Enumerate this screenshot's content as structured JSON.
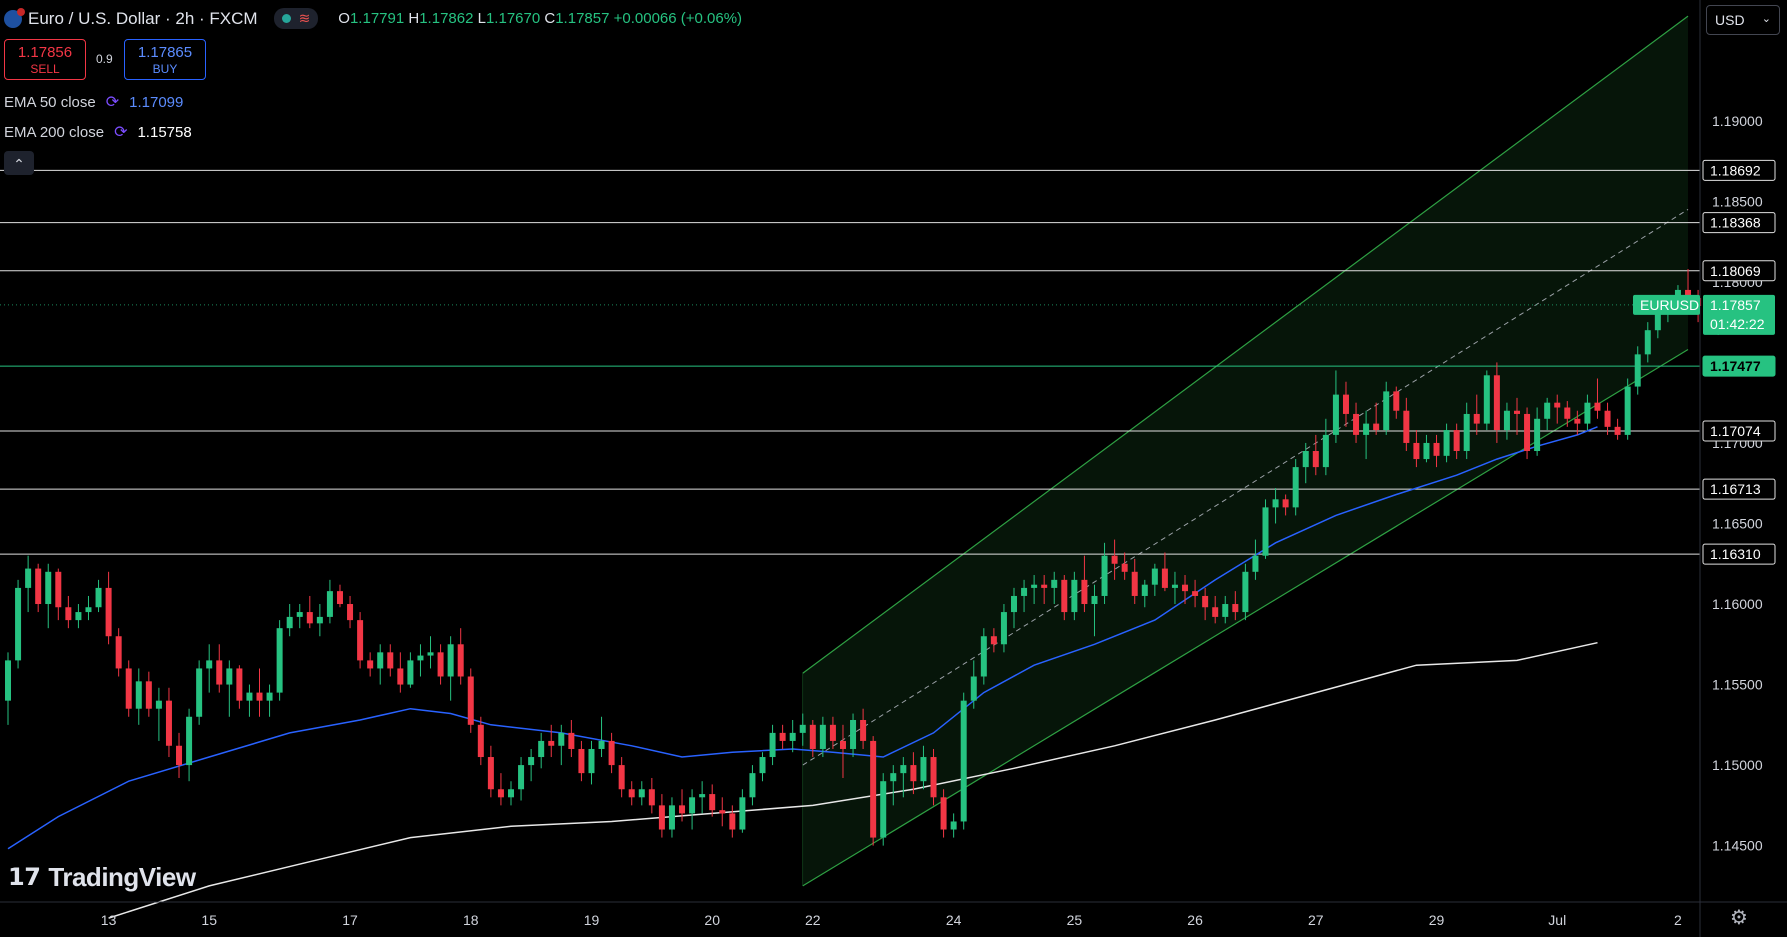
{
  "header": {
    "title": "Euro / U.S. Dollar · 2h · FXCM",
    "ohlc": {
      "o_label": "O",
      "o": "1.17791",
      "h_label": "H",
      "h": "1.17862",
      "l_label": "L",
      "l": "1.17670",
      "c_label": "C",
      "c": "1.17857",
      "change": "+0.00066 (+0.06%)"
    }
  },
  "trade": {
    "sell_price": "1.17856",
    "sell_label": "SELL",
    "spread": "0.9",
    "buy_price": "1.17865",
    "buy_label": "BUY"
  },
  "indicators": {
    "ema50_label": "EMA 50 close",
    "ema50_value": "1.17099",
    "ema200_label": "EMA 200 close",
    "ema200_value": "1.15758"
  },
  "currency_selector": "USD",
  "logo_text": "TradingView",
  "colors": {
    "background": "#000000",
    "up": "#26c281",
    "down": "#f23645",
    "ema50": "#2962ff",
    "ema200": "#e8e8e8",
    "channel": "#2ea043",
    "channel_fill": "rgba(46,160,67,0.13)",
    "price_tag": "#26c281",
    "axis_text": "#d1d4dc"
  },
  "chart_data": {
    "type": "candlestick",
    "symbol": "EURUSD",
    "last_price": "1.17857",
    "countdown": "01:42:22",
    "y_range": [
      1.1415,
      1.1975
    ],
    "y_ticks": [
      "1.19000",
      "1.18500",
      "1.18000",
      "1.17000",
      "1.16500",
      "1.16000",
      "1.15500",
      "1.15000",
      "1.14500"
    ],
    "x_ticks": [
      {
        "label": "13",
        "i": 10
      },
      {
        "label": "15",
        "i": 20
      },
      {
        "label": "17",
        "i": 34
      },
      {
        "label": "18",
        "i": 46
      },
      {
        "label": "19",
        "i": 58
      },
      {
        "label": "20",
        "i": 70
      },
      {
        "label": "22",
        "i": 80
      },
      {
        "label": "24",
        "i": 94
      },
      {
        "label": "25",
        "i": 106
      },
      {
        "label": "26",
        "i": 118
      },
      {
        "label": "27",
        "i": 130
      },
      {
        "label": "29",
        "i": 142
      },
      {
        "label": "Jul",
        "i": 154
      },
      {
        "label": "2",
        "i": 166
      }
    ],
    "horizontal_levels": [
      {
        "label": "1.18692",
        "value": 1.18692,
        "color": "#e0e0e0"
      },
      {
        "label": "1.18368",
        "value": 1.18368,
        "color": "#e0e0e0"
      },
      {
        "label": "1.18069",
        "value": 1.18069,
        "color": "#e0e0e0"
      },
      {
        "label": "1.17477",
        "value": 1.17477,
        "color": "#26c281"
      },
      {
        "label": "1.17074",
        "value": 1.17074,
        "color": "#e0e0e0"
      },
      {
        "label": "1.16713",
        "value": 1.16713,
        "color": "#e0e0e0"
      },
      {
        "label": "1.16310",
        "value": 1.1631,
        "color": "#e0e0e0"
      }
    ],
    "channel": {
      "start_i": 79,
      "end_i": 167,
      "upper": [
        1.1557,
        1.1965
      ],
      "mid": [
        1.15,
        1.1845
      ],
      "lower": [
        1.1425,
        1.1758
      ]
    },
    "candles": [
      [
        1.154,
        1.157,
        1.1525,
        1.1565
      ],
      [
        1.1565,
        1.1615,
        1.156,
        1.161
      ],
      [
        1.161,
        1.163,
        1.1595,
        1.1622
      ],
      [
        1.1622,
        1.1625,
        1.1595,
        1.16
      ],
      [
        1.16,
        1.1625,
        1.1585,
        1.162
      ],
      [
        1.162,
        1.1622,
        1.159,
        1.1598
      ],
      [
        1.1598,
        1.1605,
        1.1585,
        1.159
      ],
      [
        1.159,
        1.16,
        1.1585,
        1.1595
      ],
      [
        1.1595,
        1.1605,
        1.159,
        1.1598
      ],
      [
        1.1598,
        1.1615,
        1.1595,
        1.161
      ],
      [
        1.161,
        1.162,
        1.1575,
        1.158
      ],
      [
        1.158,
        1.1585,
        1.1555,
        1.156
      ],
      [
        1.156,
        1.1565,
        1.153,
        1.1535
      ],
      [
        1.1535,
        1.156,
        1.1525,
        1.1552
      ],
      [
        1.1552,
        1.1558,
        1.153,
        1.1535
      ],
      [
        1.1535,
        1.1548,
        1.1515,
        1.154
      ],
      [
        1.154,
        1.1548,
        1.1505,
        1.1512
      ],
      [
        1.1512,
        1.152,
        1.1492,
        1.15
      ],
      [
        1.15,
        1.1535,
        1.149,
        1.153
      ],
      [
        1.153,
        1.1565,
        1.1525,
        1.156
      ],
      [
        1.156,
        1.1575,
        1.1545,
        1.1565
      ],
      [
        1.1565,
        1.1575,
        1.1545,
        1.155
      ],
      [
        1.155,
        1.1565,
        1.153,
        1.156
      ],
      [
        1.156,
        1.1562,
        1.1535,
        1.154
      ],
      [
        1.154,
        1.155,
        1.153,
        1.1545
      ],
      [
        1.1545,
        1.156,
        1.153,
        1.154
      ],
      [
        1.154,
        1.155,
        1.153,
        1.1545
      ],
      [
        1.1545,
        1.159,
        1.154,
        1.1585
      ],
      [
        1.1585,
        1.16,
        1.158,
        1.1592
      ],
      [
        1.1592,
        1.16,
        1.1585,
        1.1595
      ],
      [
        1.1595,
        1.1605,
        1.1585,
        1.1588
      ],
      [
        1.1588,
        1.16,
        1.158,
        1.1592
      ],
      [
        1.1592,
        1.1615,
        1.1588,
        1.1608
      ],
      [
        1.1608,
        1.1612,
        1.1598,
        1.16
      ],
      [
        1.16,
        1.1605,
        1.1585,
        1.159
      ],
      [
        1.159,
        1.1595,
        1.156,
        1.1565
      ],
      [
        1.1565,
        1.157,
        1.1555,
        1.156
      ],
      [
        1.156,
        1.1575,
        1.155,
        1.157
      ],
      [
        1.157,
        1.1575,
        1.1555,
        1.156
      ],
      [
        1.156,
        1.157,
        1.1545,
        1.155
      ],
      [
        1.155,
        1.157,
        1.1548,
        1.1565
      ],
      [
        1.1565,
        1.1575,
        1.1555,
        1.1568
      ],
      [
        1.1568,
        1.158,
        1.156,
        1.157
      ],
      [
        1.157,
        1.1575,
        1.155,
        1.1555
      ],
      [
        1.1555,
        1.158,
        1.154,
        1.1575
      ],
      [
        1.1575,
        1.1585,
        1.155,
        1.1555
      ],
      [
        1.1555,
        1.156,
        1.152,
        1.1525
      ],
      [
        1.1525,
        1.153,
        1.15,
        1.1505
      ],
      [
        1.1505,
        1.1512,
        1.148,
        1.1485
      ],
      [
        1.1485,
        1.1495,
        1.1475,
        1.148
      ],
      [
        1.148,
        1.149,
        1.1475,
        1.1485
      ],
      [
        1.1485,
        1.1505,
        1.1478,
        1.15
      ],
      [
        1.15,
        1.151,
        1.149,
        1.1505
      ],
      [
        1.1505,
        1.152,
        1.1498,
        1.1515
      ],
      [
        1.1515,
        1.1525,
        1.1505,
        1.1512
      ],
      [
        1.1512,
        1.1525,
        1.15,
        1.152
      ],
      [
        1.152,
        1.1528,
        1.1505,
        1.151
      ],
      [
        1.151,
        1.1515,
        1.149,
        1.1495
      ],
      [
        1.1495,
        1.1515,
        1.1488,
        1.151
      ],
      [
        1.151,
        1.153,
        1.1505,
        1.1515
      ],
      [
        1.1515,
        1.152,
        1.1495,
        1.15
      ],
      [
        1.15,
        1.1505,
        1.148,
        1.1485
      ],
      [
        1.1485,
        1.149,
        1.1475,
        1.148
      ],
      [
        1.148,
        1.149,
        1.1475,
        1.1485
      ],
      [
        1.1485,
        1.1492,
        1.147,
        1.1475
      ],
      [
        1.1475,
        1.1482,
        1.1455,
        1.146
      ],
      [
        1.146,
        1.148,
        1.1455,
        1.1475
      ],
      [
        1.1475,
        1.1485,
        1.1465,
        1.147
      ],
      [
        1.147,
        1.1485,
        1.146,
        1.148
      ],
      [
        1.148,
        1.149,
        1.147,
        1.1482
      ],
      [
        1.1482,
        1.1488,
        1.1468,
        1.1472
      ],
      [
        1.1472,
        1.148,
        1.1462,
        1.147
      ],
      [
        1.147,
        1.1475,
        1.1455,
        1.146
      ],
      [
        1.146,
        1.1485,
        1.1458,
        1.148
      ],
      [
        1.148,
        1.15,
        1.1475,
        1.1495
      ],
      [
        1.1495,
        1.1508,
        1.149,
        1.1505
      ],
      [
        1.1505,
        1.1525,
        1.15,
        1.152
      ],
      [
        1.152,
        1.1525,
        1.151,
        1.1515
      ],
      [
        1.1515,
        1.1528,
        1.1508,
        1.152
      ],
      [
        1.152,
        1.1532,
        1.1512,
        1.1525
      ],
      [
        1.1525,
        1.1528,
        1.1505,
        1.151
      ],
      [
        1.151,
        1.153,
        1.1505,
        1.1525
      ],
      [
        1.1525,
        1.153,
        1.151,
        1.1515
      ],
      [
        1.1515,
        1.1525,
        1.1492,
        1.151
      ],
      [
        1.151,
        1.1532,
        1.1505,
        1.1528
      ],
      [
        1.1528,
        1.1535,
        1.151,
        1.1515
      ],
      [
        1.1515,
        1.1518,
        1.145,
        1.1455
      ],
      [
        1.1455,
        1.1495,
        1.145,
        1.149
      ],
      [
        1.149,
        1.15,
        1.1475,
        1.1495
      ],
      [
        1.1495,
        1.1505,
        1.148,
        1.15
      ],
      [
        1.15,
        1.1508,
        1.1482,
        1.149
      ],
      [
        1.149,
        1.1512,
        1.1485,
        1.1505
      ],
      [
        1.1505,
        1.151,
        1.1475,
        1.148
      ],
      [
        1.148,
        1.1485,
        1.1455,
        1.146
      ],
      [
        1.146,
        1.147,
        1.1455,
        1.1465
      ],
      [
        1.1465,
        1.1545,
        1.146,
        1.154
      ],
      [
        1.154,
        1.1565,
        1.1535,
        1.1555
      ],
      [
        1.1555,
        1.1585,
        1.155,
        1.158
      ],
      [
        1.158,
        1.1585,
        1.157,
        1.1575
      ],
      [
        1.1575,
        1.16,
        1.157,
        1.1595
      ],
      [
        1.1595,
        1.161,
        1.1585,
        1.1605
      ],
      [
        1.1605,
        1.1615,
        1.1595,
        1.161
      ],
      [
        1.161,
        1.1618,
        1.16,
        1.1612
      ],
      [
        1.1612,
        1.1618,
        1.16,
        1.161
      ],
      [
        1.161,
        1.162,
        1.16,
        1.1615
      ],
      [
        1.1615,
        1.1618,
        1.159,
        1.1595
      ],
      [
        1.1595,
        1.162,
        1.159,
        1.1615
      ],
      [
        1.1615,
        1.163,
        1.1595,
        1.16
      ],
      [
        1.16,
        1.1612,
        1.158,
        1.1605
      ],
      [
        1.1605,
        1.1638,
        1.16,
        1.163
      ],
      [
        1.163,
        1.164,
        1.1615,
        1.1625
      ],
      [
        1.1625,
        1.1632,
        1.1615,
        1.162
      ],
      [
        1.162,
        1.1628,
        1.16,
        1.1605
      ],
      [
        1.1605,
        1.1615,
        1.1598,
        1.1612
      ],
      [
        1.1612,
        1.1625,
        1.1605,
        1.1622
      ],
      [
        1.1622,
        1.1632,
        1.1608,
        1.161
      ],
      [
        1.161,
        1.162,
        1.16,
        1.1612
      ],
      [
        1.1612,
        1.1618,
        1.16,
        1.1608
      ],
      [
        1.1608,
        1.1615,
        1.1598,
        1.1605
      ],
      [
        1.1605,
        1.161,
        1.159,
        1.1598
      ],
      [
        1.1598,
        1.1605,
        1.1588,
        1.1592
      ],
      [
        1.1592,
        1.1605,
        1.1588,
        1.16
      ],
      [
        1.16,
        1.1608,
        1.159,
        1.1595
      ],
      [
        1.1595,
        1.1625,
        1.159,
        1.162
      ],
      [
        1.162,
        1.164,
        1.1615,
        1.163
      ],
      [
        1.163,
        1.1665,
        1.1628,
        1.166
      ],
      [
        1.166,
        1.1672,
        1.165,
        1.1665
      ],
      [
        1.1665,
        1.1668,
        1.1655,
        1.166
      ],
      [
        1.166,
        1.169,
        1.1655,
        1.1685
      ],
      [
        1.1685,
        1.17,
        1.1675,
        1.1695
      ],
      [
        1.1695,
        1.1705,
        1.168,
        1.1685
      ],
      [
        1.1685,
        1.1715,
        1.168,
        1.1705
      ],
      [
        1.1705,
        1.1745,
        1.17,
        1.173
      ],
      [
        1.173,
        1.1738,
        1.171,
        1.1718
      ],
      [
        1.1718,
        1.1725,
        1.17,
        1.1705
      ],
      [
        1.1705,
        1.172,
        1.169,
        1.1712
      ],
      [
        1.1712,
        1.1725,
        1.1705,
        1.1708
      ],
      [
        1.1708,
        1.1738,
        1.1705,
        1.1732
      ],
      [
        1.1732,
        1.1735,
        1.1715,
        1.172
      ],
      [
        1.172,
        1.1728,
        1.1695,
        1.17
      ],
      [
        1.17,
        1.1708,
        1.1685,
        1.169
      ],
      [
        1.169,
        1.1705,
        1.1688,
        1.17
      ],
      [
        1.17,
        1.1705,
        1.1685,
        1.1692
      ],
      [
        1.1692,
        1.1712,
        1.1688,
        1.1708
      ],
      [
        1.1708,
        1.1712,
        1.169,
        1.1695
      ],
      [
        1.1695,
        1.1725,
        1.169,
        1.1718
      ],
      [
        1.1718,
        1.173,
        1.1705,
        1.1712
      ],
      [
        1.1712,
        1.1745,
        1.1708,
        1.1742
      ],
      [
        1.1742,
        1.175,
        1.17,
        1.1708
      ],
      [
        1.1708,
        1.1725,
        1.1702,
        1.172
      ],
      [
        1.172,
        1.1728,
        1.1705,
        1.1718
      ],
      [
        1.1718,
        1.1722,
        1.169,
        1.1695
      ],
      [
        1.1695,
        1.1722,
        1.1692,
        1.1715
      ],
      [
        1.1715,
        1.1728,
        1.1708,
        1.1725
      ],
      [
        1.1725,
        1.173,
        1.1712,
        1.1722
      ],
      [
        1.1722,
        1.1726,
        1.171,
        1.1715
      ],
      [
        1.1715,
        1.172,
        1.1705,
        1.1712
      ],
      [
        1.1712,
        1.173,
        1.1708,
        1.1725
      ],
      [
        1.1725,
        1.174,
        1.1715,
        1.172
      ],
      [
        1.172,
        1.1725,
        1.1705,
        1.171
      ],
      [
        1.171,
        1.1715,
        1.1702,
        1.1705
      ],
      [
        1.1705,
        1.174,
        1.1702,
        1.1735
      ],
      [
        1.1735,
        1.176,
        1.173,
        1.1755
      ],
      [
        1.1755,
        1.1775,
        1.175,
        1.177
      ],
      [
        1.177,
        1.1785,
        1.1765,
        1.1782
      ],
      [
        1.1782,
        1.179,
        1.1775,
        1.1785
      ],
      [
        1.1785,
        1.1798,
        1.178,
        1.1795
      ],
      [
        1.1795,
        1.1808,
        1.1785,
        1.179
      ],
      [
        1.179,
        1.1795,
        1.1775,
        1.1785
      ],
      [
        1.1785,
        1.179,
        1.1775,
        1.1779
      ],
      [
        1.1779,
        1.1786,
        1.1767,
        1.1786
      ]
    ],
    "ema50": [
      [
        0,
        1.1448
      ],
      [
        5,
        1.1468
      ],
      [
        12,
        1.149
      ],
      [
        20,
        1.1505
      ],
      [
        28,
        1.152
      ],
      [
        35,
        1.1528
      ],
      [
        40,
        1.1535
      ],
      [
        44,
        1.1532
      ],
      [
        48,
        1.1525
      ],
      [
        55,
        1.152
      ],
      [
        62,
        1.1512
      ],
      [
        67,
        1.1505
      ],
      [
        72,
        1.1508
      ],
      [
        78,
        1.151
      ],
      [
        82,
        1.1508
      ],
      [
        87,
        1.1505
      ],
      [
        92,
        1.152
      ],
      [
        97,
        1.1545
      ],
      [
        102,
        1.1562
      ],
      [
        108,
        1.1575
      ],
      [
        114,
        1.159
      ],
      [
        120,
        1.1615
      ],
      [
        126,
        1.1638
      ],
      [
        132,
        1.1655
      ],
      [
        138,
        1.1668
      ],
      [
        144,
        1.168
      ],
      [
        148,
        1.169
      ],
      [
        152,
        1.1698
      ],
      [
        156,
        1.1705
      ],
      [
        158,
        1.171
      ]
    ],
    "ema200": [
      [
        10,
        1.1405
      ],
      [
        20,
        1.1425
      ],
      [
        30,
        1.144
      ],
      [
        40,
        1.1455
      ],
      [
        50,
        1.1462
      ],
      [
        60,
        1.1465
      ],
      [
        70,
        1.147
      ],
      [
        80,
        1.1475
      ],
      [
        90,
        1.1485
      ],
      [
        100,
        1.1498
      ],
      [
        110,
        1.1512
      ],
      [
        120,
        1.1528
      ],
      [
        130,
        1.1545
      ],
      [
        140,
        1.1562
      ],
      [
        150,
        1.1565
      ],
      [
        158,
        1.1576
      ]
    ]
  }
}
